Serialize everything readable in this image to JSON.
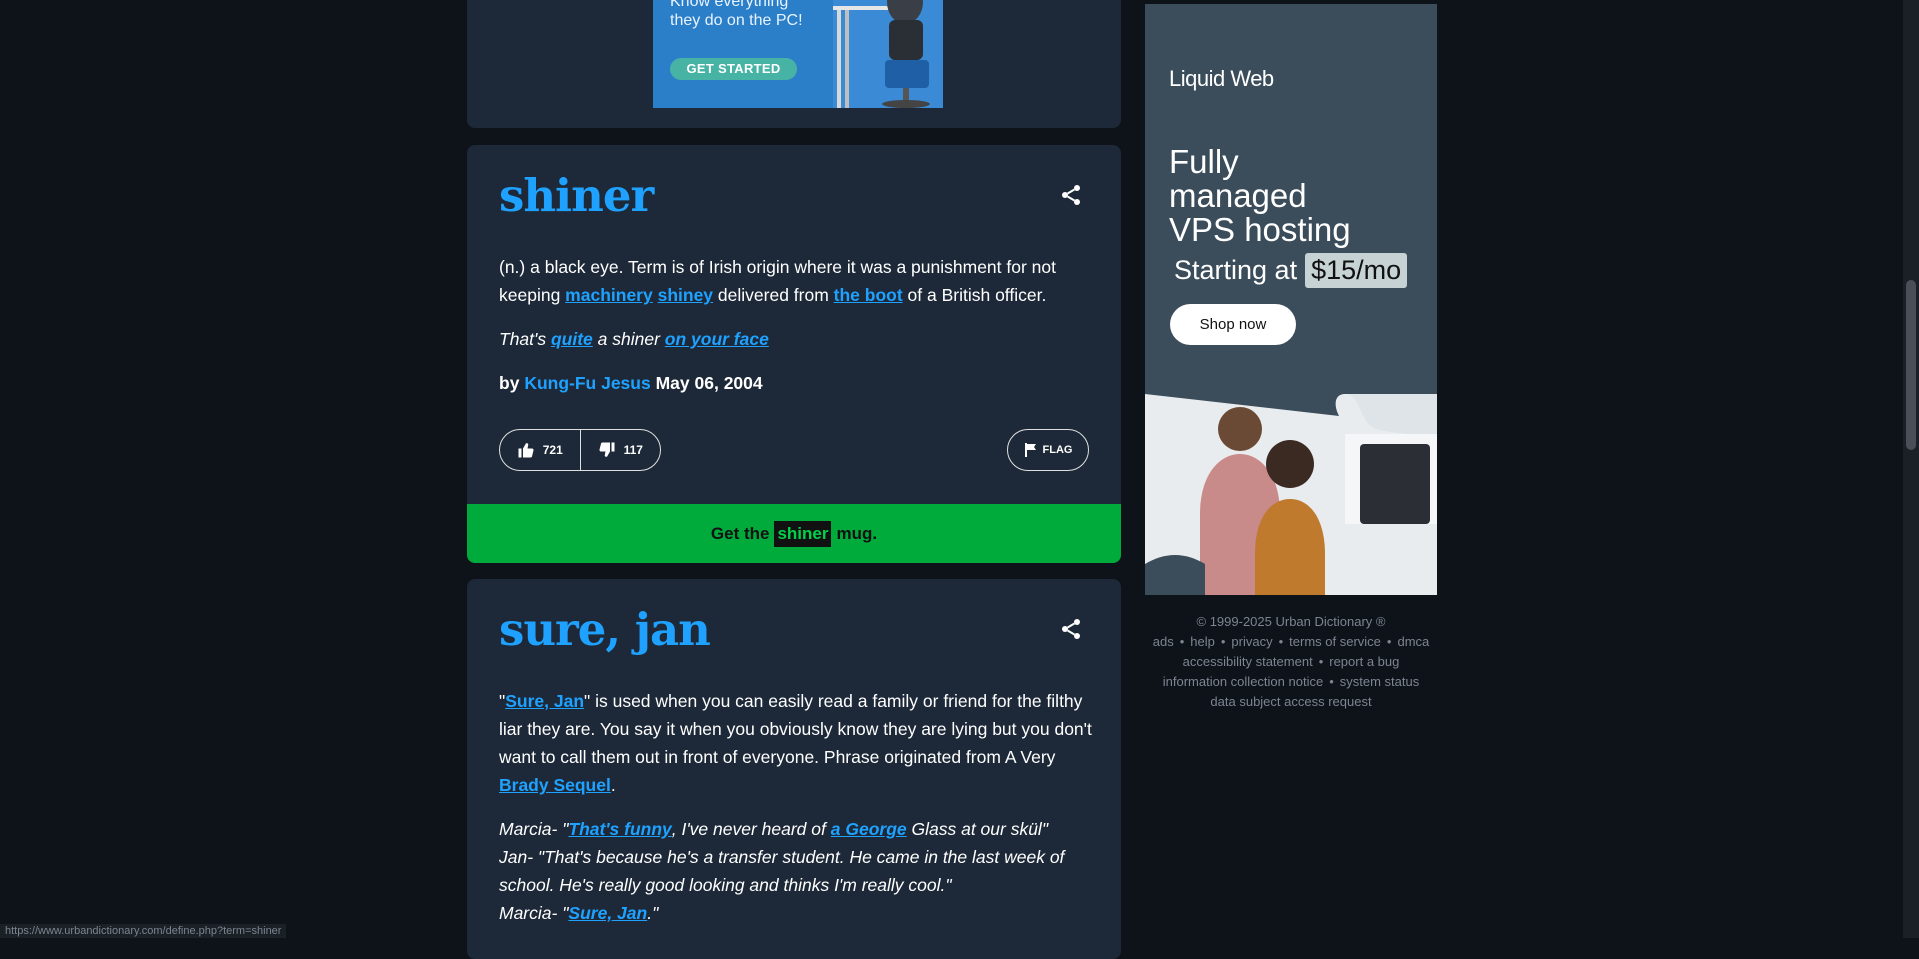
{
  "top_ad": {
    "line1": "Know everything",
    "line2": "they do on the PC!",
    "cta": "GET STARTED"
  },
  "definitions": [
    {
      "word": "shiner",
      "meaning": [
        {
          "t": "(n.) a black eye. Term is of Irish origin where it was a punishment for not keeping "
        },
        {
          "l": "machinery"
        },
        {
          "t": " "
        },
        {
          "l": "shiney"
        },
        {
          "t": " delivered from "
        },
        {
          "l": "the boot"
        },
        {
          "t": " of a British officer."
        }
      ],
      "example": [
        {
          "t": "That's "
        },
        {
          "l": "quite"
        },
        {
          "t": " a shiner "
        },
        {
          "l": "on your face"
        }
      ],
      "by": "by",
      "author": "Kung-Fu Jesus",
      "date": "May 06, 2004",
      "upvotes": "721",
      "downvotes": "117",
      "flag_label": "FLAG",
      "mug": {
        "pre": "Get the",
        "word": "shiner",
        "post": "mug."
      }
    },
    {
      "word": "sure, jan",
      "meaning": [
        {
          "t": "\""
        },
        {
          "l": "Sure, Jan"
        },
        {
          "t": "\" is used when you can easily read a family or friend for the filthy liar they are. You say it when you obviously know they are lying but you don't want to call them out in front of everyone. Phrase originated from A Very "
        },
        {
          "l": "Brady Sequel"
        },
        {
          "t": "."
        }
      ],
      "example": [
        {
          "t": "Marcia- \""
        },
        {
          "l": "That's funny"
        },
        {
          "t": ", I've never heard of "
        },
        {
          "l": "a George"
        },
        {
          "t": " Glass at our skül\""
        },
        {
          "br": true
        },
        {
          "t": "Jan- \"That's because he's a transfer student. He came in the last week of school. He's really good looking and thinks I'm really cool.\""
        },
        {
          "br": true
        },
        {
          "t": "Marcia- \""
        },
        {
          "l": "Sure, Jan"
        },
        {
          "t": ".\""
        }
      ]
    }
  ],
  "side_ad": {
    "brand": "Liquid Web",
    "headline": [
      "Fully",
      "managed",
      "VPS hosting"
    ],
    "starting": "Starting at",
    "price": "$15/mo",
    "cta": "Shop now"
  },
  "footer": {
    "copyright": "© 1999-2025 Urban Dictionary ®",
    "row1": [
      "ads",
      "help",
      "privacy",
      "terms of service",
      "dmca"
    ],
    "row2": [
      "accessibility statement",
      "report a bug"
    ],
    "row3": [
      "information collection notice",
      "system status"
    ],
    "row4": [
      "data subject access request"
    ]
  },
  "status_url": "https://www.urbandictionary.com/define.php?term=shiner",
  "colors": {
    "accent": "#1fa2ff",
    "card": "#1d2938",
    "background": "#0e1219",
    "mug": "#00ab3c"
  }
}
